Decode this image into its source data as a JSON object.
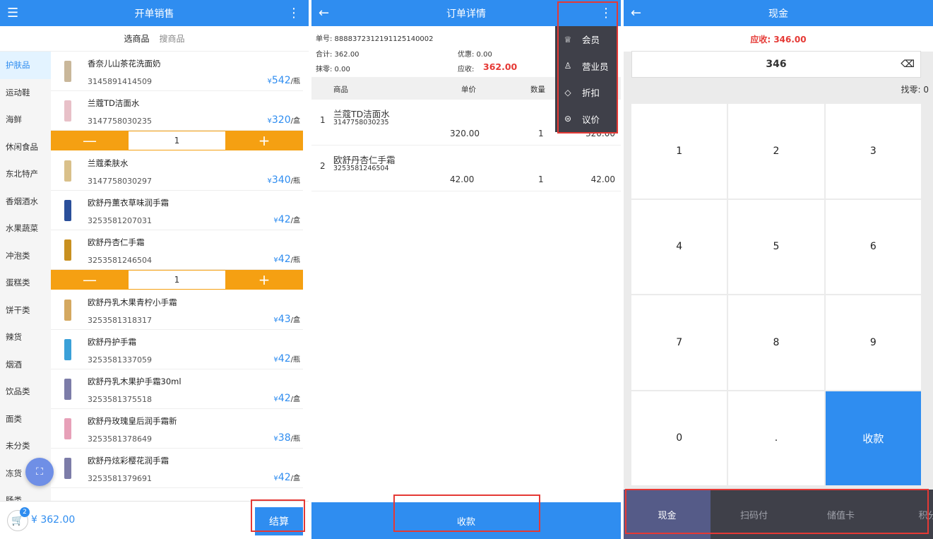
{
  "colors": {
    "primary": "#2f8df0",
    "accent": "#f5a012",
    "danger": "#e53935",
    "menu_bg": "#3f4049"
  },
  "sales": {
    "title": "开单销售",
    "menu_icon": "hamburger-icon",
    "more_icon": "more-vertical-icon",
    "tabs": [
      "选商品",
      "搜商品"
    ],
    "categories": [
      "护肤品",
      "运动鞋",
      "海鲜",
      "休闲食品",
      "东北特产",
      "香烟酒水",
      "水果蔬菜",
      "冲泡类",
      "蛋糕类",
      "饼干类",
      "辣货",
      "烟酒",
      "饮品类",
      "面类",
      "未分类",
      "冻货",
      "肠类"
    ],
    "products": [
      {
        "name": "香奈儿山茶花洗面奶",
        "code": "3145891414509",
        "price": "542",
        "unit": "/瓶"
      },
      {
        "name": "兰蔻TD洁面水",
        "code": "3147758030235",
        "price": "320",
        "unit": "/盒",
        "qty": "1"
      },
      {
        "name": "兰蔻柔肤水",
        "code": "3147758030297",
        "price": "340",
        "unit": "/瓶"
      },
      {
        "name": "欧舒丹薰衣草味润手霜",
        "code": "3253581207031",
        "price": "42",
        "unit": "/盒"
      },
      {
        "name": "欧舒丹杏仁手霜",
        "code": "3253581246504",
        "price": "42",
        "unit": "/瓶",
        "qty": "1"
      },
      {
        "name": "欧舒丹乳木果青柠小手霜",
        "code": "3253581318317",
        "price": "43",
        "unit": "/盒"
      },
      {
        "name": "欧舒丹护手霜",
        "code": "3253581337059",
        "price": "42",
        "unit": "/瓶"
      },
      {
        "name": "欧舒丹乳木果护手霜30ml",
        "code": "3253581375518",
        "price": "42",
        "unit": "/盒"
      },
      {
        "name": "欧舒丹玫瑰皇后润手霜新",
        "code": "3253581378649",
        "price": "38",
        "unit": "/瓶"
      },
      {
        "name": "欧舒丹炫彩樱花润手霜",
        "code": "3253581379691",
        "price": "42",
        "unit": "/盒"
      }
    ],
    "currency": "¥",
    "minus": "—",
    "plus": "+",
    "cart_count": "2",
    "total": "¥ 362.00",
    "checkout_label": "结算"
  },
  "order": {
    "title": "订单详情",
    "back_icon": "arrow-left-icon",
    "order_no": "单号: 8888372312191125140002",
    "subtotal": "合计: 362.00",
    "discount": "优惠: 0.00",
    "rounding": "抹零: 0.00",
    "due_label": "应收:",
    "due_value": "362.00",
    "columns": [
      "商品",
      "单价",
      "数量"
    ],
    "items": [
      {
        "index": "1",
        "name": "兰蔻TD洁面水",
        "code": "3147758030235",
        "price": "320.00",
        "qty": "1",
        "amount": "320.00"
      },
      {
        "index": "2",
        "name": "欧舒丹杏仁手霜",
        "code": "3253581246504",
        "price": "42.00",
        "qty": "1",
        "amount": "42.00"
      }
    ],
    "menu": [
      {
        "icon": "crown-icon",
        "glyph": "♕",
        "label": "会员"
      },
      {
        "icon": "person-icon",
        "glyph": "♙",
        "label": "营业员"
      },
      {
        "icon": "tag-icon",
        "glyph": "◇",
        "label": "折扣"
      },
      {
        "icon": "yen-circle-icon",
        "glyph": "⊜",
        "label": "议价"
      }
    ],
    "collect_label": "收款"
  },
  "cash": {
    "title": "现金",
    "due": "应收: 346.00",
    "amount": "346",
    "change": "找零: 0",
    "keys": [
      "1",
      "2",
      "3",
      "4",
      "5",
      "6",
      "7",
      "8",
      "9",
      "0",
      "."
    ],
    "collect_label": "收款",
    "payments": [
      "现金",
      "扫码付",
      "储值卡",
      "积分"
    ]
  }
}
